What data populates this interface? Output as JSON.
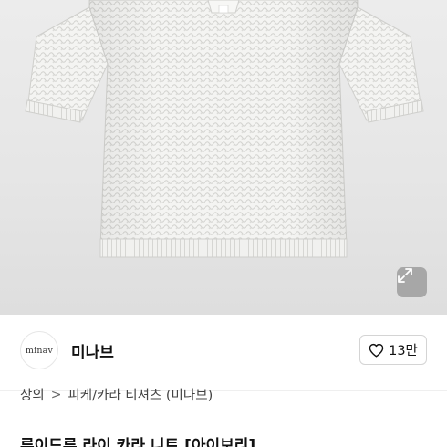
{
  "brand": {
    "logo_text": "minav",
    "name": "미나브",
    "like_count": "13만"
  },
  "breadcrumb": {
    "category": "상의",
    "separator": ">",
    "subcategory": "피케/카라 티셔츠 (미나브)"
  },
  "product": {
    "title_peek": "루이드루 라이 카라 니트 [아이보리]"
  },
  "icons": {
    "expand": "expand-arrows-icon",
    "like": "heart-outline-icon"
  },
  "colors": {
    "image_background": "#e9e9e9",
    "shirt": "#f3f3f1",
    "text_primary": "#111111",
    "border": "#d4d4d4"
  }
}
